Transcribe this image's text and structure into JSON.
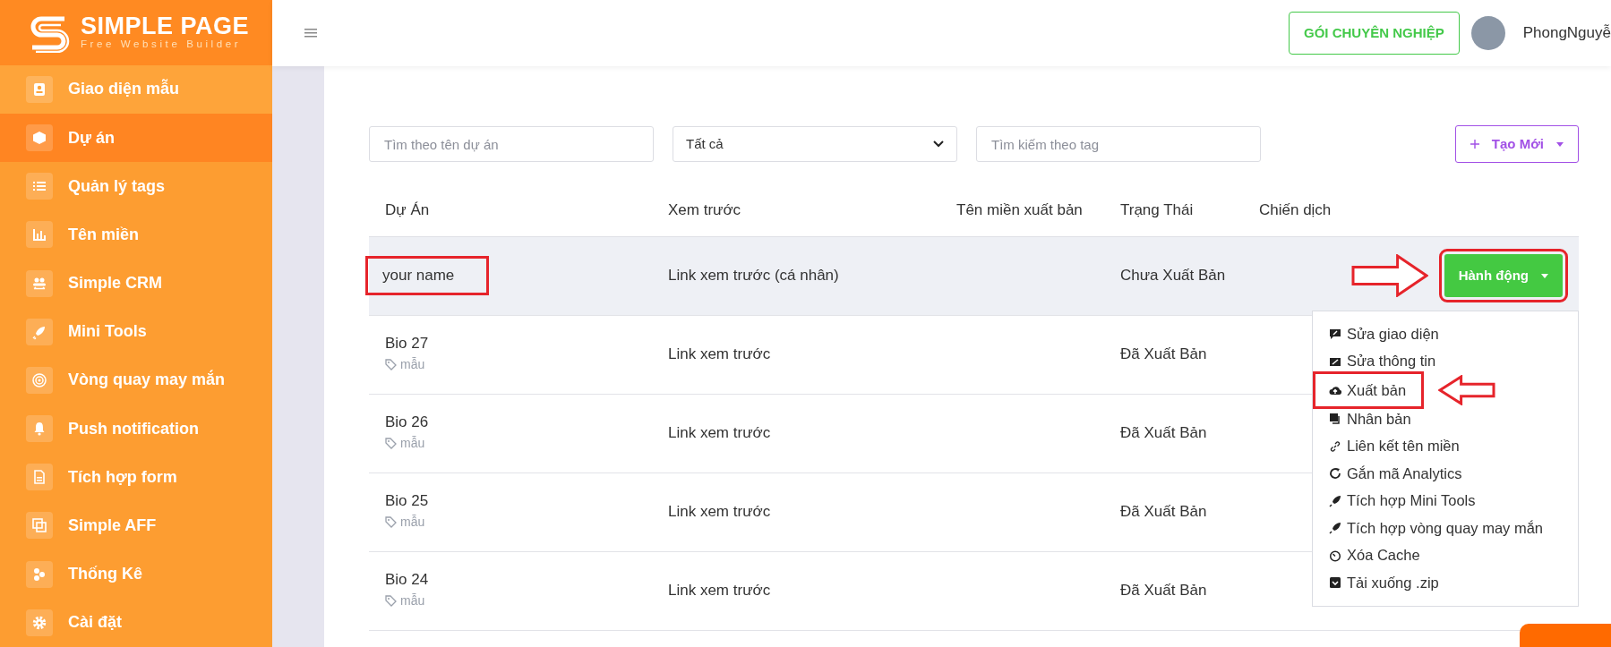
{
  "brand": {
    "name": "SIMPLE PAGE",
    "tagline": "Free Website Builder"
  },
  "sidebar": {
    "items": [
      {
        "label": "Giao diện mẫu",
        "selected": false
      },
      {
        "label": "Dự án",
        "selected": true
      },
      {
        "label": "Quản lý tags",
        "selected": false
      },
      {
        "label": "Tên miền",
        "selected": false
      },
      {
        "label": "Simple CRM",
        "selected": false
      },
      {
        "label": "Mini Tools",
        "selected": false
      },
      {
        "label": "Vòng quay may mắn",
        "selected": false
      },
      {
        "label": "Push notification",
        "selected": false
      },
      {
        "label": "Tích hợp form",
        "selected": false
      },
      {
        "label": "Simple AFF",
        "selected": false
      },
      {
        "label": "Thống Kê",
        "selected": false
      },
      {
        "label": "Cài đặt",
        "selected": false
      }
    ]
  },
  "header": {
    "upgrade_button": "GÓI CHUYÊN NGHIỆP",
    "username": "PhongNguyễ"
  },
  "filters": {
    "name_search": {
      "placeholder": "Tìm theo tên dự án"
    },
    "status_select": {
      "value": "Tất cả"
    },
    "tag_search": {
      "placeholder": "Tìm kiếm theo tag"
    },
    "create_button": "Tạo Mới"
  },
  "table": {
    "columns": [
      "Dự Án",
      "Xem trước",
      "Tên miền xuất bản",
      "Trạng Thái",
      "Chiến dịch"
    ],
    "rows": [
      {
        "name": "your name",
        "framed": true,
        "selected": true,
        "preview": "Link xem trước (cá nhân)",
        "status": "Chưa Xuất Bản",
        "action": {
          "label": "Hành động",
          "framed": true,
          "arrow": true
        }
      },
      {
        "name": "Bio 27",
        "tag": "mẫu",
        "framed": false,
        "selected": false,
        "preview": "Link xem trước",
        "status": "Đã Xuất Bản"
      },
      {
        "name": "Bio 26",
        "tag": "mẫu",
        "framed": false,
        "selected": false,
        "preview": "Link xem trước",
        "status": "Đã Xuất Bản"
      },
      {
        "name": "Bio 25",
        "tag": "mẫu",
        "framed": false,
        "selected": false,
        "preview": "Link xem trước",
        "status": "Đã Xuất Bản"
      },
      {
        "name": "Bio 24",
        "tag": "mẫu",
        "framed": false,
        "selected": false,
        "preview": "Link xem trước",
        "status": "Đã Xuất Bản"
      }
    ]
  },
  "action_menu": {
    "items": [
      {
        "label": "Sửa giao diện",
        "framed": false,
        "arrow": false
      },
      {
        "label": "Sửa thông tin",
        "framed": false,
        "arrow": false
      },
      {
        "label": "Xuất bản",
        "framed": true,
        "arrow": true
      },
      {
        "label": "Nhân bản",
        "framed": false,
        "arrow": false
      },
      {
        "label": "Liên kết tên miền",
        "framed": false,
        "arrow": false
      },
      {
        "label": "Gắn mã Analytics",
        "framed": false,
        "arrow": false
      },
      {
        "label": "Tích hợp Mini Tools",
        "framed": false,
        "arrow": false
      },
      {
        "label": "Tích hợp vòng quay may mắn",
        "framed": false,
        "arrow": false
      },
      {
        "label": "Xóa Cache",
        "framed": false,
        "arrow": false
      },
      {
        "label": "Tải xuống .zip",
        "framed": false,
        "arrow": false
      }
    ]
  }
}
